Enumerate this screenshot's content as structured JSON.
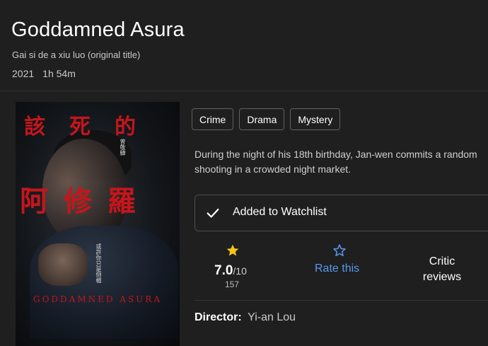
{
  "header": {
    "title": "Goddamned Asura",
    "original_title": "Gai si de a xiu luo (original title)",
    "year": "2021",
    "runtime": "1h 54m"
  },
  "poster": {
    "cjk_top": "該死的",
    "cjk_mid": "阿修羅",
    "small_vertical_1": "曾敬驊",
    "small_vertical_2": "或許你只是倒楣",
    "english_title": "GODDAMNED ASURA"
  },
  "genres": [
    "Crime",
    "Drama",
    "Mystery"
  ],
  "plot": "During the night of his 18th birthday, Jan-wen commits a random shooting in a crowded night market.",
  "watchlist": {
    "label": "Added to Watchlist",
    "icon": "checkmark-icon"
  },
  "ratings": {
    "imdb": {
      "score": "7.0",
      "out_of": "/10",
      "votes": "157",
      "star_color": "#f5c518"
    },
    "rate": {
      "label": "Rate this",
      "color": "#5799ef"
    },
    "critic": {
      "label": "Critic reviews"
    }
  },
  "director": {
    "key": "Director:",
    "value": "Yi-an Lou"
  }
}
